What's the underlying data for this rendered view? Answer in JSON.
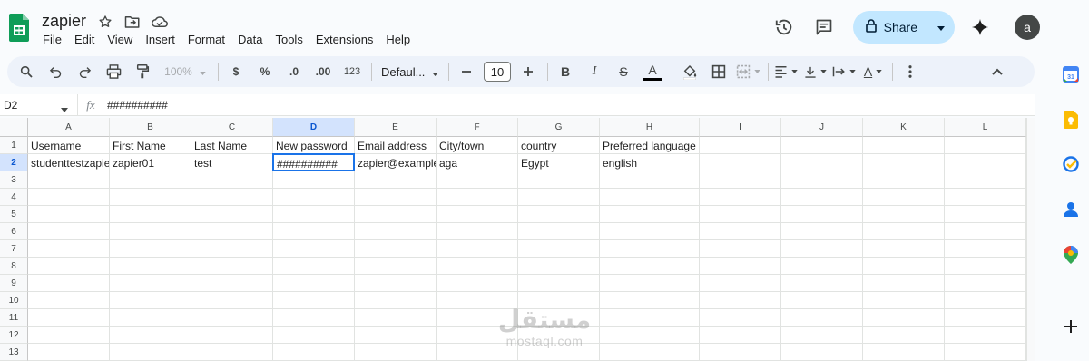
{
  "app": {
    "title": "zapier",
    "menu": [
      "File",
      "Edit",
      "View",
      "Insert",
      "Format",
      "Data",
      "Tools",
      "Extensions",
      "Help"
    ],
    "share_label": "Share",
    "avatar_letter": "a",
    "brand_color": "#0f9d58",
    "accent_color": "#c2e7ff"
  },
  "toolbar": {
    "zoom": "100%",
    "currency": "$",
    "percent": "%",
    "dec_decrease": ".0",
    "dec_increase": ".00",
    "number_format": "123",
    "font_name": "Defaul...",
    "font_size": "10",
    "bold": "B",
    "italic": "I",
    "strike": "S",
    "text_color": "A",
    "text_rotate": "A"
  },
  "formula_bar": {
    "cell_ref": "D2",
    "fx": "fx",
    "content": "##########"
  },
  "grid": {
    "columns": [
      "A",
      "B",
      "C",
      "D",
      "E",
      "F",
      "G",
      "H",
      "I",
      "J",
      "K",
      "L"
    ],
    "selected_column": "D",
    "rows": [
      "1",
      "2",
      "3",
      "4",
      "5",
      "6",
      "7",
      "8",
      "9",
      "10",
      "11",
      "12",
      "13"
    ],
    "selected_row": "2",
    "data": [
      [
        "Username",
        "First Name",
        "Last Name",
        "New password",
        "Email address",
        "City/town",
        "country",
        "Preferred language"
      ],
      [
        "studenttestzapier",
        "zapier01",
        "test",
        "##########",
        "zapier@example.com",
        "aga",
        "Egypt",
        "english"
      ]
    ]
  },
  "watermark": {
    "arabic": "مستقل",
    "latin": "mostaql.com"
  }
}
